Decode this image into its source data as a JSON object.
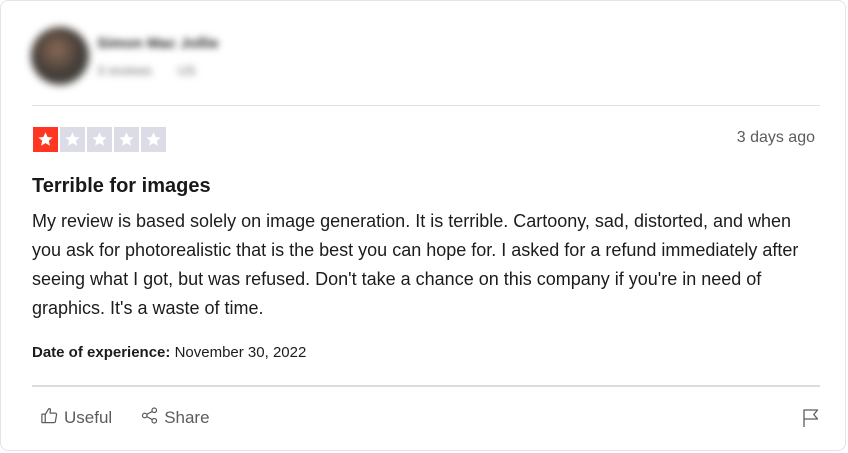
{
  "reviewer": {
    "name": "Simon Mac Jollie",
    "meta_reviews": "3 reviews",
    "meta_country": "US"
  },
  "review": {
    "rating": 1,
    "rating_max": 5,
    "star_filled_color": "#ff3722",
    "star_empty_color": "#dcdce6",
    "posted": "3 days ago",
    "title": "Terrible for images",
    "body": "My review is based solely on image generation. It is terrible. Cartoony, sad, distorted, and when you ask for photorealistic that is the best you can hope for. I asked for a refund immediately after seeing what I got, but was refused. Don't take a chance on this company if you're in need of graphics. It's a waste of time.",
    "experience_label": "Date of experience:",
    "experience_date": "November 30, 2022"
  },
  "actions": {
    "useful_label": "Useful",
    "useful_icon": "thumbs-up-icon",
    "share_label": "Share",
    "share_icon": "share-icon",
    "report_icon": "flag-icon"
  }
}
